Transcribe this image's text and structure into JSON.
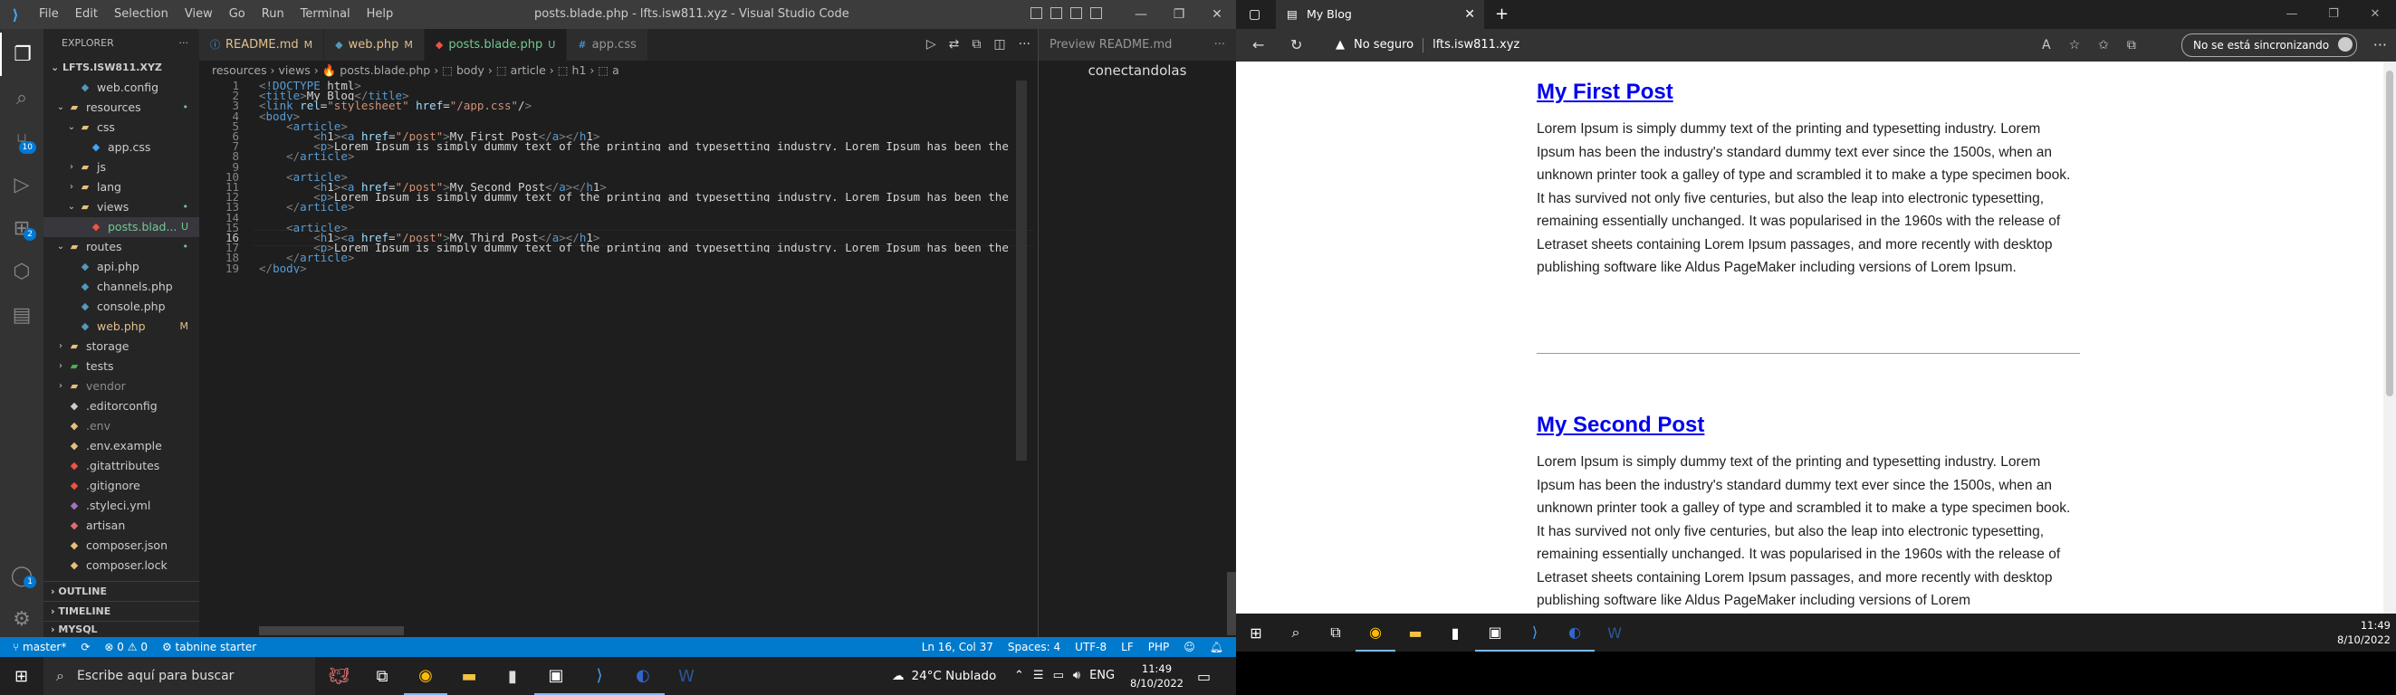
{
  "vscode": {
    "window_title": "posts.blade.php - lfts.isw811.xyz - Visual Studio Code",
    "menu": [
      "File",
      "Edit",
      "Selection",
      "View",
      "Go",
      "Run",
      "Terminal",
      "Help"
    ],
    "window_buttons": [
      "—",
      "❐",
      "✕"
    ],
    "activity": {
      "source_badge": "10",
      "extensions_badge": "2",
      "accounts_badge": "1"
    },
    "explorer": {
      "title": "EXPLORER",
      "root": "LFTS.ISW811.XYZ",
      "items": [
        {
          "label": "web.config",
          "indent": 1,
          "type": "file",
          "color": "#519aba",
          "mark": ""
        },
        {
          "label": "resources",
          "indent": 0,
          "type": "folder-open",
          "color": "#e5c07b",
          "mark": "•"
        },
        {
          "label": "css",
          "indent": 1,
          "type": "folder-open",
          "color": "#e5c07b",
          "mark": ""
        },
        {
          "label": "app.css",
          "indent": 2,
          "type": "file",
          "color": "#42a5f5",
          "mark": ""
        },
        {
          "label": "js",
          "indent": 1,
          "type": "folder",
          "color": "#e5c07b",
          "mark": ""
        },
        {
          "label": "lang",
          "indent": 1,
          "type": "folder",
          "color": "#e5c07b",
          "mark": ""
        },
        {
          "label": "views",
          "indent": 1,
          "type": "folder-open",
          "color": "#e5c07b",
          "mark": "•"
        },
        {
          "label": "posts.blad...",
          "indent": 2,
          "type": "file",
          "color": "#f05340",
          "mark": "U",
          "selected": true
        },
        {
          "label": "routes",
          "indent": 0,
          "type": "folder-open",
          "color": "#e5c07b",
          "mark": "•"
        },
        {
          "label": "api.php",
          "indent": 1,
          "type": "file",
          "color": "#519aba",
          "mark": ""
        },
        {
          "label": "channels.php",
          "indent": 1,
          "type": "file",
          "color": "#519aba",
          "mark": ""
        },
        {
          "label": "console.php",
          "indent": 1,
          "type": "file",
          "color": "#519aba",
          "mark": ""
        },
        {
          "label": "web.php",
          "indent": 1,
          "type": "file",
          "color": "#519aba",
          "mark": "M"
        },
        {
          "label": "storage",
          "indent": 0,
          "type": "folder",
          "color": "#e5c07b",
          "mark": ""
        },
        {
          "label": "tests",
          "indent": 0,
          "type": "folder",
          "color": "#4caf50",
          "mark": ""
        },
        {
          "label": "vendor",
          "indent": 0,
          "type": "folder",
          "color": "#e5c07b",
          "mark": "",
          "dim": true
        },
        {
          "label": ".editorconfig",
          "indent": 0,
          "type": "file",
          "color": "#ccc",
          "mark": ""
        },
        {
          "label": ".env",
          "indent": 0,
          "type": "file",
          "color": "#e5c07b",
          "mark": "",
          "dim": true
        },
        {
          "label": ".env.example",
          "indent": 0,
          "type": "file",
          "color": "#e5c07b",
          "mark": ""
        },
        {
          "label": ".gitattributes",
          "indent": 0,
          "type": "file",
          "color": "#f05340",
          "mark": ""
        },
        {
          "label": ".gitignore",
          "indent": 0,
          "type": "file",
          "color": "#f05340",
          "mark": ""
        },
        {
          "label": ".styleci.yml",
          "indent": 0,
          "type": "file",
          "color": "#a074c4",
          "mark": ""
        },
        {
          "label": "artisan",
          "indent": 0,
          "type": "file",
          "color": "#e06c75",
          "mark": ""
        },
        {
          "label": "composer.json",
          "indent": 0,
          "type": "file",
          "color": "#e5c07b",
          "mark": ""
        },
        {
          "label": "composer.lock",
          "indent": 0,
          "type": "file",
          "color": "#e5c07b",
          "mark": ""
        }
      ],
      "sections": [
        "OUTLINE",
        "TIMELINE",
        "MYSQL"
      ]
    },
    "tabs": [
      {
        "label": "README.md",
        "mod": "M",
        "icon": "ⓘ",
        "color": "#42a5f5"
      },
      {
        "label": "web.php",
        "mod": "M",
        "icon": "◆",
        "color": "#519aba"
      },
      {
        "label": "posts.blade.php",
        "mod": "U",
        "icon": "◆",
        "color": "#f05340",
        "active": true
      },
      {
        "label": "app.css",
        "mod": "",
        "icon": "#",
        "color": "#42a5f5"
      }
    ],
    "breadcrumb": "resources › views › 🔥 posts.blade.php › ⬚ body › ⬚ article › ⬚ h1 › ⬚ a",
    "code_lines": [
      "<!DOCTYPE html>",
      "<title>My Blog</title>",
      "<link rel=\"stylesheet\" href=\"/app.css\"/>",
      "<body>",
      "    <article>",
      "        <h1><a href=\"/post\">My First Post</a></h1>",
      "        <p>Lorem Ipsum is simply dummy text of the printing and typesetting industry. Lorem Ipsum has been the i",
      "    </article>",
      "",
      "    <article>",
      "        <h1><a href=\"/post\">My Second Post</a></h1>",
      "        <p>Lorem Ipsum is simply dummy text of the printing and typesetting industry. Lorem Ipsum has been the i",
      "    </article>",
      "",
      "    <article>",
      "        <h1><a href=\"/post\">My Third Post</a></h1>",
      "        <p>Lorem Ipsum is simply dummy text of the printing and typesetting industry. Lorem Ipsum has been the i",
      "    </article>",
      "</body>"
    ],
    "current_line": 16,
    "preview": {
      "tab_label": "Preview README.md",
      "text": "conectandolas"
    },
    "status": {
      "branch": "master*",
      "errors": "⊗ 0",
      "warnings": "⚠ 0",
      "tabnine": "tabnine starter",
      "position": "Ln 16, Col 37",
      "spaces": "Spaces: 4",
      "encoding": "UTF-8",
      "eol": "LF",
      "language": "PHP"
    }
  },
  "taskbar": {
    "search_placeholder": "Escribe aquí para buscar",
    "weather": "24°C  Nublado",
    "lang": "ENG",
    "time": "11:49",
    "date": "8/10/2022"
  },
  "browser": {
    "tab_title": "My Blog",
    "security": "No seguro",
    "url": "lfts.isw811.xyz",
    "sync_label": "No se está sincronizando",
    "posts": [
      {
        "title": "My First Post",
        "body": "Lorem Ipsum is simply dummy text of the printing and typesetting industry. Lorem Ipsum has been the industry's standard dummy text ever since the 1500s, when an unknown printer took a galley of type and scrambled it to make a type specimen book. It has survived not only five centuries, but also the leap into electronic typesetting, remaining essentially unchanged. It was popularised in the 1960s with the release of Letraset sheets containing Lorem Ipsum passages, and more recently with desktop publishing software like Aldus PageMaker including versions of Lorem Ipsum."
      },
      {
        "title": "My Second Post",
        "body": "Lorem Ipsum is simply dummy text of the printing and typesetting industry. Lorem Ipsum has been the industry's standard dummy text ever since the 1500s, when an unknown printer took a galley of type and scrambled it to make a type specimen book. It has survived not only five centuries, but also the leap into electronic typesetting, remaining essentially unchanged. It was popularised in the 1960s with the release of Letraset sheets containing Lorem Ipsum passages, and more recently with desktop publishing software like Aldus PageMaker including versions of Lorem"
      }
    ],
    "time": "11:49",
    "date": "8/10/2022"
  },
  "colors": {
    "vscode_status": "#007acc",
    "link": "#0000ee",
    "accent": "#3ea6ff"
  }
}
